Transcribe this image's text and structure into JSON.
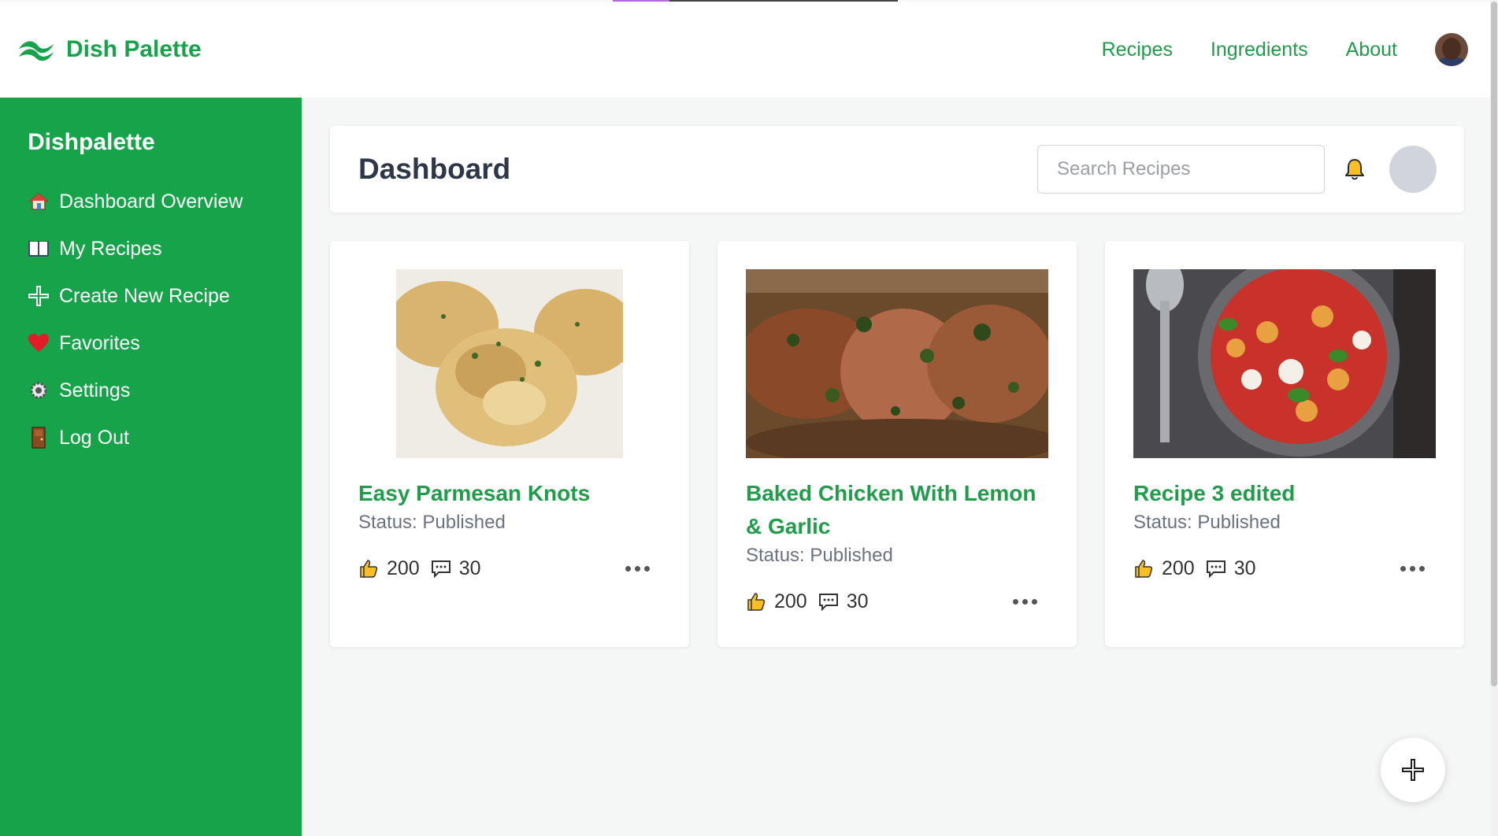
{
  "header": {
    "brand": "Dish Palette",
    "nav": [
      {
        "label": "Recipes"
      },
      {
        "label": "Ingredients"
      },
      {
        "label": "About"
      }
    ]
  },
  "sidebar": {
    "title": "Dishpalette",
    "items": [
      {
        "label": "Dashboard Overview",
        "icon": "house-icon"
      },
      {
        "label": "My Recipes",
        "icon": "book-icon"
      },
      {
        "label": "Create New Recipe",
        "icon": "plus-icon"
      },
      {
        "label": "Favorites",
        "icon": "heart-icon"
      },
      {
        "label": "Settings",
        "icon": "gear-icon"
      },
      {
        "label": "Log Out",
        "icon": "door-icon"
      }
    ]
  },
  "dashboard": {
    "title": "Dashboard",
    "search_placeholder": "Search Recipes"
  },
  "cards": [
    {
      "title": "Easy Parmesan Knots",
      "status": "Status: Published",
      "likes": "200",
      "comments": "30",
      "image": "garlic-knots-photo"
    },
    {
      "title": "Baked Chicken With Lemon & Garlic",
      "status": "Status: Published",
      "likes": "200",
      "comments": "30",
      "image": "baked-chicken-photo"
    },
    {
      "title": "Recipe 3 edited",
      "status": "Status: Published",
      "likes": "200",
      "comments": "30",
      "image": "gnocchi-skillet-photo"
    }
  ],
  "colors": {
    "brand_green": "#16a34a",
    "link_green": "#1f9d4a",
    "heading": "#2d3748",
    "muted": "#6b7280"
  }
}
